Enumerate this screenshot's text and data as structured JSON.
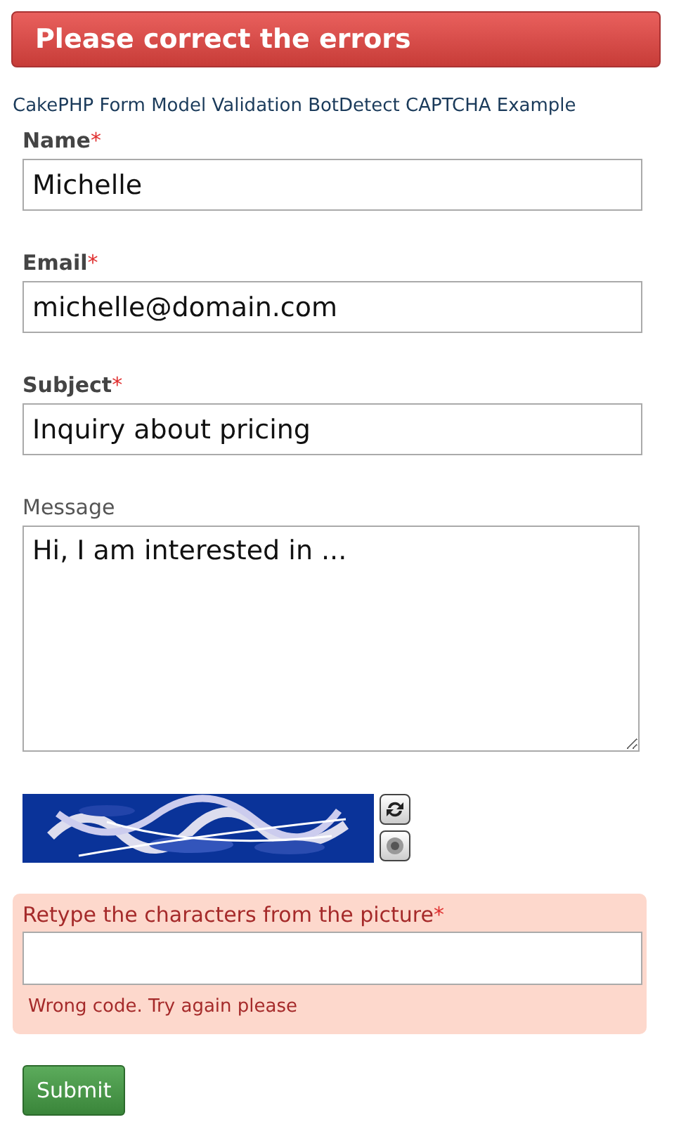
{
  "alert": {
    "title": "Please correct the errors"
  },
  "caption": "CakePHP Form Model Validation BotDetect CAPTCHA Example",
  "fields": [
    {
      "kind": "input",
      "label": "Name",
      "required": true,
      "marker": "*",
      "value": "Michelle"
    },
    {
      "kind": "input",
      "label": "Email",
      "required": true,
      "marker": "*",
      "value": "michelle@domain.com"
    },
    {
      "kind": "input",
      "label": "Subject",
      "required": true,
      "marker": "*",
      "value": "Inquiry about pricing"
    },
    {
      "kind": "textarea",
      "label": "Message",
      "required": false,
      "value": "Hi, I am interested in ..."
    }
  ],
  "captcha": {
    "kind": "picture",
    "label": "Retype the characters from the picture",
    "marker": "*",
    "error": "Wrong code. Try again please"
  },
  "submit": "Submit"
}
